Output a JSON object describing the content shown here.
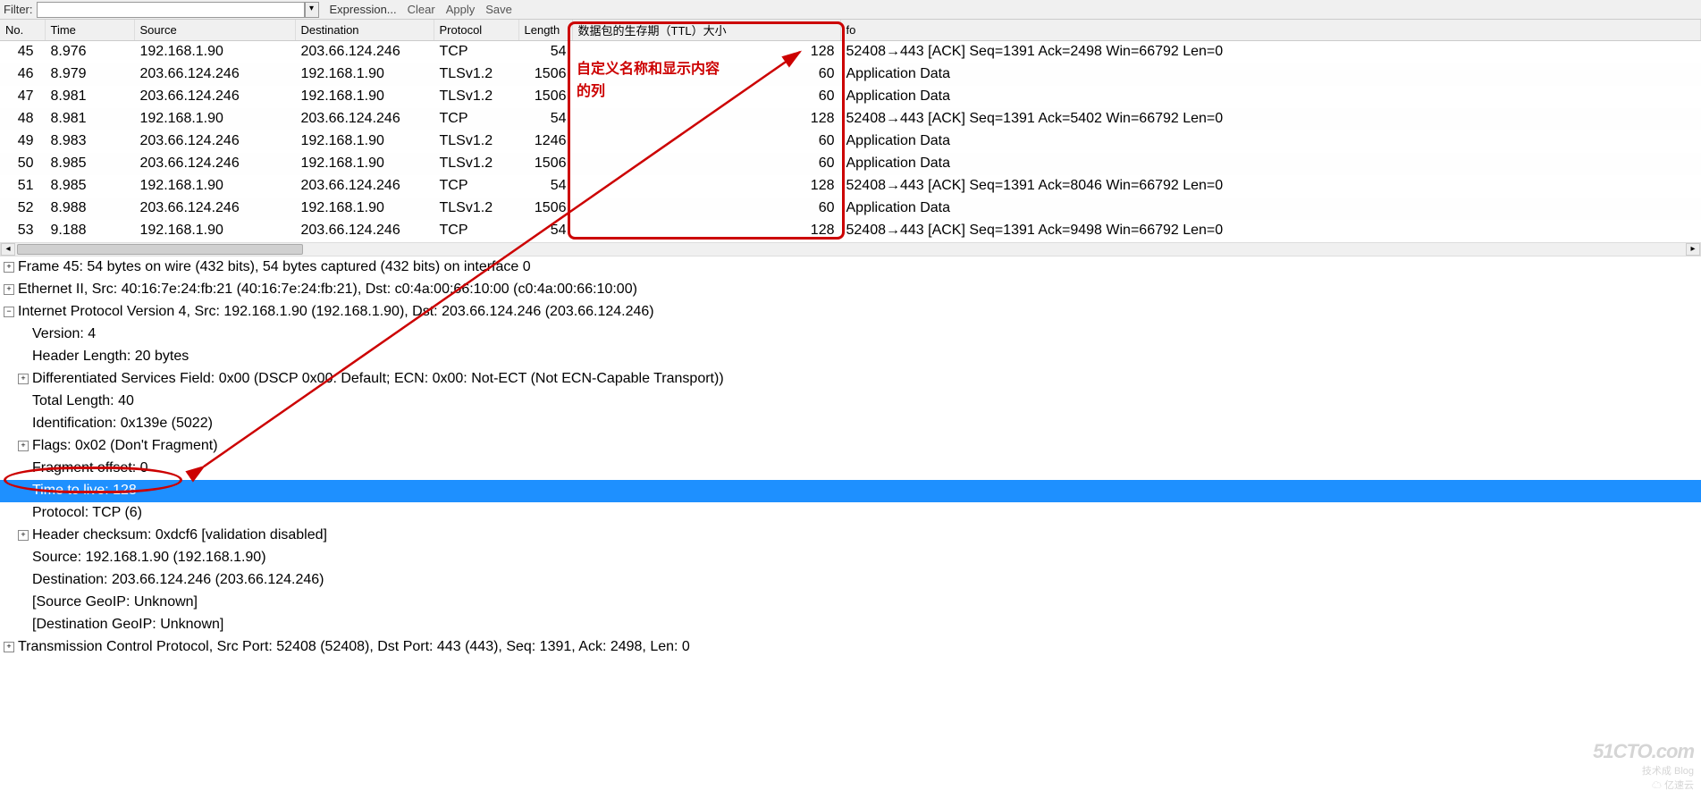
{
  "toolbar": {
    "filter_label": "Filter:",
    "filter_value": "",
    "expression": "Expression...",
    "clear": "Clear",
    "apply": "Apply",
    "save": "Save"
  },
  "columns": {
    "no": "No.",
    "time": "Time",
    "source": "Source",
    "destination": "Destination",
    "protocol": "Protocol",
    "length": "Length",
    "ttl": "数据包的生存期（TTL）大小",
    "info": "fo"
  },
  "packets": [
    {
      "no": "45",
      "time": "8.976",
      "src": "192.168.1.90",
      "dst": "203.66.124.246",
      "proto": "TCP",
      "len": "54",
      "ttl": "128",
      "info": "52408→443 [ACK] Seq=1391 Ack=2498 Win=66792 Len=0"
    },
    {
      "no": "46",
      "time": "8.979",
      "src": "203.66.124.246",
      "dst": "192.168.1.90",
      "proto": "TLSv1.2",
      "len": "1506",
      "ttl": "60",
      "info": "Application Data"
    },
    {
      "no": "47",
      "time": "8.981",
      "src": "203.66.124.246",
      "dst": "192.168.1.90",
      "proto": "TLSv1.2",
      "len": "1506",
      "ttl": "60",
      "info": "Application Data"
    },
    {
      "no": "48",
      "time": "8.981",
      "src": "192.168.1.90",
      "dst": "203.66.124.246",
      "proto": "TCP",
      "len": "54",
      "ttl": "128",
      "info": "52408→443 [ACK] Seq=1391 Ack=5402 Win=66792 Len=0"
    },
    {
      "no": "49",
      "time": "8.983",
      "src": "203.66.124.246",
      "dst": "192.168.1.90",
      "proto": "TLSv1.2",
      "len": "1246",
      "ttl": "60",
      "info": "Application Data"
    },
    {
      "no": "50",
      "time": "8.985",
      "src": "203.66.124.246",
      "dst": "192.168.1.90",
      "proto": "TLSv1.2",
      "len": "1506",
      "ttl": "60",
      "info": "Application Data"
    },
    {
      "no": "51",
      "time": "8.985",
      "src": "192.168.1.90",
      "dst": "203.66.124.246",
      "proto": "TCP",
      "len": "54",
      "ttl": "128",
      "info": "52408→443 [ACK] Seq=1391 Ack=8046 Win=66792 Len=0"
    },
    {
      "no": "52",
      "time": "8.988",
      "src": "203.66.124.246",
      "dst": "192.168.1.90",
      "proto": "TLSv1.2",
      "len": "1506",
      "ttl": "60",
      "info": "Application Data"
    },
    {
      "no": "53",
      "time": "9.188",
      "src": "192.168.1.90",
      "dst": "203.66.124.246",
      "proto": "TCP",
      "len": "54",
      "ttl": "128",
      "info": "52408→443 [ACK] Seq=1391 Ack=9498 Win=66792 Len=0"
    }
  ],
  "details": {
    "frame": "Frame 45: 54 bytes on wire (432 bits), 54 bytes captured (432 bits) on interface 0",
    "eth": "Ethernet II, Src: 40:16:7e:24:fb:21 (40:16:7e:24:fb:21), Dst: c0:4a:00:66:10:00 (c0:4a:00:66:10:00)",
    "ip": "Internet Protocol Version 4, Src: 192.168.1.90 (192.168.1.90), Dst: 203.66.124.246 (203.66.124.246)",
    "version": "Version: 4",
    "hlen": "Header Length: 20 bytes",
    "dsf": "Differentiated Services Field: 0x00 (DSCP 0x00: Default; ECN: 0x00: Not-ECT (Not ECN-Capable Transport))",
    "tlen": "Total Length: 40",
    "ident": "Identification: 0x139e (5022)",
    "flags": "Flags: 0x02 (Don't Fragment)",
    "fragoff": "Fragment offset: 0",
    "ttl": "Time to live: 128",
    "proto": "Protocol: TCP (6)",
    "checksum": "Header checksum: 0xdcf6 [validation disabled]",
    "src": "Source: 192.168.1.90 (192.168.1.90)",
    "dst": "Destination: 203.66.124.246 (203.66.124.246)",
    "geosrc": "[Source GeoIP: Unknown]",
    "geodst": "[Destination GeoIP: Unknown]",
    "tcp": "Transmission Control Protocol, Src Port: 52408 (52408), Dst Port: 443 (443), Seq: 1391, Ack: 2498, Len: 0"
  },
  "annotations": {
    "label1": "自定义名称和显示内容",
    "label2": "的列"
  },
  "watermark": {
    "line1": "51CTO.com",
    "line2": "技术成 Blog",
    "line3": "亿速云"
  }
}
